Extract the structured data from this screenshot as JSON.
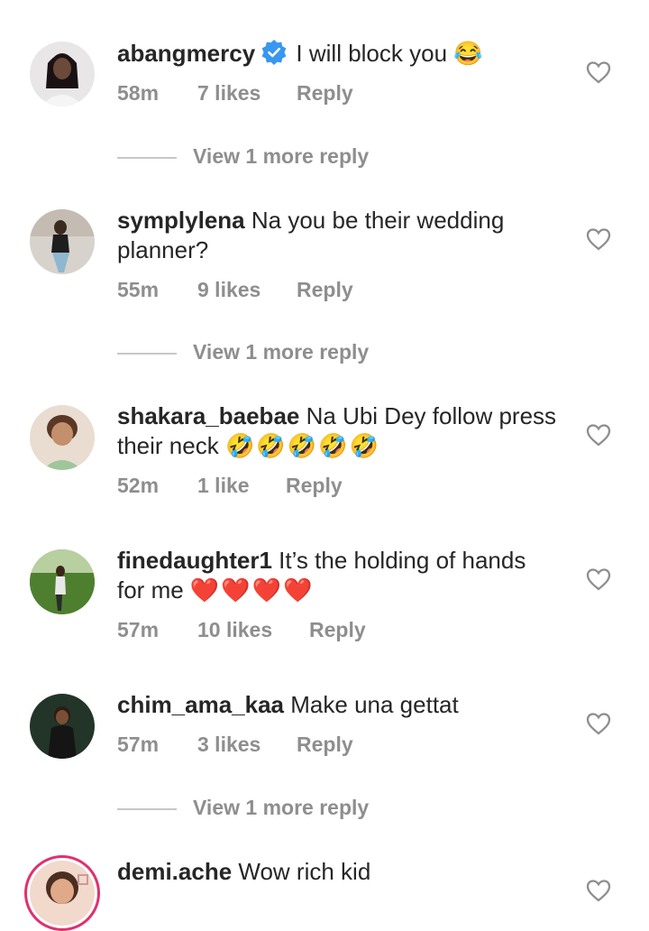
{
  "comments": [
    {
      "username": "abangmercy",
      "text": "I will block you",
      "emoji": "😂",
      "time": "58m",
      "likes": "7 likes",
      "reply": "Reply"
    },
    {
      "username": "symplylena",
      "text": "Na you be their wedding planner?",
      "time": "55m",
      "likes": "9 likes",
      "reply": "Reply"
    },
    {
      "username": "shakara_baebae",
      "text": "Na Ubi  Dey follow press their neck",
      "emoji": "🤣🤣🤣🤣🤣",
      "time": "52m",
      "likes": "1 like",
      "reply": "Reply"
    },
    {
      "username": "finedaughter1",
      "text": "It’s the holding of hands for me",
      "emoji": "❤️❤️❤️❤️",
      "time": "57m",
      "likes": "10 likes",
      "reply": "Reply"
    },
    {
      "username": "chim_ama_kaa",
      "text": "Make una gettat",
      "time": "57m",
      "likes": "3 likes",
      "reply": "Reply"
    },
    {
      "username": "demi.ache",
      "text": "Wow rich kid"
    }
  ],
  "view_more": "View 1 more reply",
  "colors": {
    "verified": "#3897f0",
    "story_ring": "#e1306c",
    "meta": "#8e8e8e",
    "text": "#262626"
  }
}
